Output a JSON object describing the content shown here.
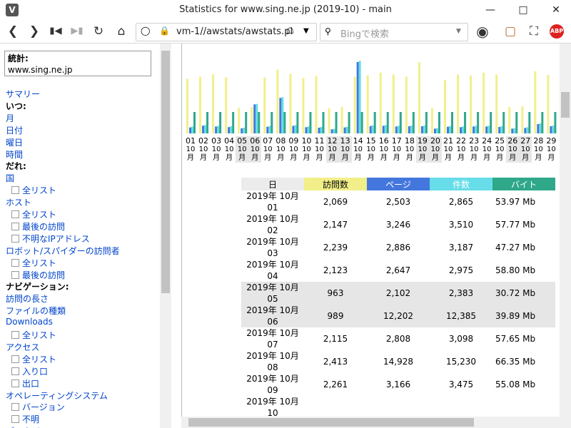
{
  "window": {
    "title": "Statistics for www.sing.ne.jp (2019-10) - main",
    "app_icon": "V"
  },
  "toolbar": {
    "url": "vm-1//awstats/awstats.pl",
    "search_placeholder": "Bingで検索"
  },
  "sidebar": {
    "box_label": "統計:",
    "box_value": "www.sing.ne.jp",
    "items": [
      {
        "text": "サマリー",
        "type": "link",
        "level": 0
      },
      {
        "text": "いつ:",
        "type": "bold",
        "level": 0
      },
      {
        "text": "月",
        "type": "link",
        "level": 0
      },
      {
        "text": "日付",
        "type": "link",
        "level": 0
      },
      {
        "text": "曜日",
        "type": "link",
        "level": 0
      },
      {
        "text": "時間",
        "type": "link",
        "level": 0
      },
      {
        "text": "だれ:",
        "type": "bold",
        "level": 0
      },
      {
        "text": "国",
        "type": "link",
        "level": 0
      },
      {
        "text": "全リスト",
        "type": "link",
        "level": 1
      },
      {
        "text": "ホスト",
        "type": "link",
        "level": 0
      },
      {
        "text": "全リスト",
        "type": "link",
        "level": 1
      },
      {
        "text": "最後の訪問",
        "type": "link",
        "level": 1
      },
      {
        "text": "不明なIPアドレス",
        "type": "link",
        "level": 1
      },
      {
        "text": "ロボット/スパイダーの訪問者",
        "type": "link",
        "level": 0
      },
      {
        "text": "全リスト",
        "type": "link",
        "level": 1
      },
      {
        "text": "最後の訪問",
        "type": "link",
        "level": 1
      },
      {
        "text": "ナビゲーション:",
        "type": "bold",
        "level": 0
      },
      {
        "text": "訪問の長さ",
        "type": "link",
        "level": 0
      },
      {
        "text": "ファイルの種類",
        "type": "link",
        "level": 0
      },
      {
        "text": "Downloads",
        "type": "link",
        "level": 0
      },
      {
        "text": "全リスト",
        "type": "link",
        "level": 1
      },
      {
        "text": "アクセス",
        "type": "link",
        "level": 0
      },
      {
        "text": "全リスト",
        "type": "link",
        "level": 1
      },
      {
        "text": "入り口",
        "type": "link",
        "level": 1
      },
      {
        "text": "出口",
        "type": "link",
        "level": 1
      },
      {
        "text": "オペレーティングシステム",
        "type": "link",
        "level": 0
      },
      {
        "text": "バージョン",
        "type": "link",
        "level": 1
      },
      {
        "text": "不明",
        "type": "link",
        "level": 1
      },
      {
        "text": "ブラウザ",
        "type": "link",
        "level": 0
      }
    ]
  },
  "chart_data": {
    "type": "bar",
    "categories": [
      "01",
      "02",
      "03",
      "04",
      "05",
      "06",
      "07",
      "08",
      "09",
      "10",
      "11",
      "12",
      "13",
      "14",
      "15",
      "16",
      "17",
      "18",
      "19",
      "20",
      "21",
      "22",
      "23",
      "24",
      "25",
      "26",
      "27",
      "28",
      "29"
    ],
    "month_label": "10月",
    "weekend": [
      "05",
      "06",
      "12",
      "13",
      "19",
      "20",
      "26",
      "27"
    ],
    "series": [
      {
        "name": "訪問数",
        "color": "#f2ef8a",
        "values": [
          2069,
          2147,
          2239,
          2123,
          963,
          989,
          2115,
          2413,
          2261,
          2100,
          2180,
          950,
          1000,
          2150,
          2200,
          2300,
          2230,
          2150,
          2700,
          960,
          2010,
          2230,
          2190,
          2300,
          2230,
          1000,
          1020,
          2350,
          2210
        ]
      },
      {
        "name": "ページ",
        "color": "#4477dd",
        "values": [
          2503,
          3246,
          2886,
          2647,
          2102,
          12202,
          2808,
          14928,
          3166,
          2600,
          2400,
          1700,
          2500,
          30000,
          3100,
          3200,
          2900,
          3000,
          3000,
          2000,
          2800,
          2600,
          2900,
          2900,
          2700,
          2000,
          2300,
          3900,
          3000
        ]
      },
      {
        "name": "件数",
        "color": "#66dde8",
        "values": [
          2865,
          3510,
          3187,
          2975,
          2383,
          12385,
          3098,
          15230,
          3475,
          2900,
          2700,
          1900,
          2800,
          30500,
          3400,
          3500,
          3200,
          3300,
          3300,
          2200,
          3100,
          2900,
          3200,
          3200,
          3000,
          2200,
          2600,
          4200,
          3300
        ]
      },
      {
        "name": "バイト",
        "color": "#2fa88a",
        "values": [
          53.97,
          57.77,
          47.27,
          58.8,
          30.72,
          39.89,
          57.65,
          66.35,
          55.08,
          52,
          50,
          35,
          40,
          70,
          54,
          56,
          55,
          52,
          90,
          38,
          50,
          52,
          53,
          55,
          52,
          35,
          38,
          60,
          54
        ]
      }
    ]
  },
  "table": {
    "headers": [
      "日",
      "訪問数",
      "ページ",
      "件数",
      "バイト"
    ],
    "rows": [
      {
        "date_a": "2019年 10月",
        "date_b": "01",
        "visits": "2,069",
        "pages": "2,503",
        "hits": "2,865",
        "bytes": "53.97 Mb",
        "we": false
      },
      {
        "date_a": "2019年 10月",
        "date_b": "02",
        "visits": "2,147",
        "pages": "3,246",
        "hits": "3,510",
        "bytes": "57.77 Mb",
        "we": false
      },
      {
        "date_a": "2019年 10月",
        "date_b": "03",
        "visits": "2,239",
        "pages": "2,886",
        "hits": "3,187",
        "bytes": "47.27 Mb",
        "we": false
      },
      {
        "date_a": "2019年 10月",
        "date_b": "04",
        "visits": "2,123",
        "pages": "2,647",
        "hits": "2,975",
        "bytes": "58.80 Mb",
        "we": false
      },
      {
        "date_a": "2019年 10月",
        "date_b": "05",
        "visits": "963",
        "pages": "2,102",
        "hits": "2,383",
        "bytes": "30.72 Mb",
        "we": true
      },
      {
        "date_a": "2019年 10月",
        "date_b": "06",
        "visits": "989",
        "pages": "12,202",
        "hits": "12,385",
        "bytes": "39.89 Mb",
        "we": true
      },
      {
        "date_a": "2019年 10月",
        "date_b": "07",
        "visits": "2,115",
        "pages": "2,808",
        "hits": "3,098",
        "bytes": "57.65 Mb",
        "we": false
      },
      {
        "date_a": "2019年 10月",
        "date_b": "08",
        "visits": "2,413",
        "pages": "14,928",
        "hits": "15,230",
        "bytes": "66.35 Mb",
        "we": false
      },
      {
        "date_a": "2019年 10月",
        "date_b": "09",
        "visits": "2,261",
        "pages": "3,166",
        "hits": "3,475",
        "bytes": "55.08 Mb",
        "we": false
      },
      {
        "date_a": "2019年 10月",
        "date_b": "10",
        "visits": "",
        "pages": "",
        "hits": "",
        "bytes": "",
        "we": false
      }
    ]
  }
}
